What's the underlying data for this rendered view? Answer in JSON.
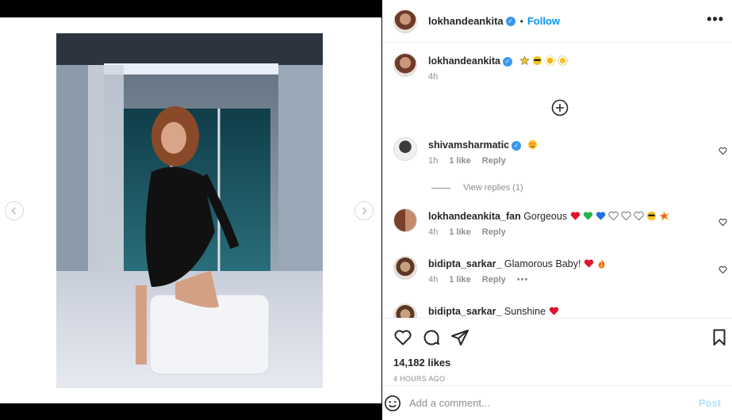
{
  "post": {
    "author": "lokhandeankita",
    "follow_label": "Follow",
    "dot": "•",
    "more": "•••"
  },
  "caption": {
    "username": "lokhandeankita",
    "emoji_icons": [
      "star-emoji",
      "sunglasses-face-emoji",
      "sun-emoji",
      "sun-face-emoji"
    ],
    "time": "4h"
  },
  "comments": [
    {
      "username": "shivamsharmatic",
      "text": "",
      "emoji_icons": [
        "heart-eyes-emoji"
      ],
      "time": "1h",
      "likes": "1 like",
      "reply": "Reply"
    },
    {
      "username": "lokhandeankita_fan",
      "text": "Gorgeous",
      "emoji_icons": [
        "red-heart-emoji",
        "green-heart-emoji",
        "blue-heart-emoji",
        "white-heart-emoji",
        "white-heart-emoji",
        "white-heart-emoji",
        "sunglasses-face-emoji",
        "collision-emoji"
      ],
      "time": "4h",
      "likes": "1 like",
      "reply": "Reply"
    },
    {
      "username": "bidipta_sarkar_",
      "text": "Glamorous Baby!",
      "emoji_icons": [
        "red-heart-emoji",
        "fire-emoji"
      ],
      "time": "4h",
      "likes": "1 like",
      "reply": "Reply",
      "options": "•••"
    },
    {
      "username": "bidipta_sarkar_",
      "text": "Sunshine",
      "emoji_icons": [
        "red-heart-emoji"
      ]
    }
  ],
  "view_replies": "View replies (1)",
  "stats": {
    "likes": "14,182 likes",
    "time_ago": "4 HOURS AGO"
  },
  "add_comment": {
    "placeholder": "Add a comment...",
    "post_label": "Post"
  },
  "colors": {
    "accent": "#0095f6",
    "post_disabled": "#b2dffc",
    "verified": "#3897f0"
  }
}
